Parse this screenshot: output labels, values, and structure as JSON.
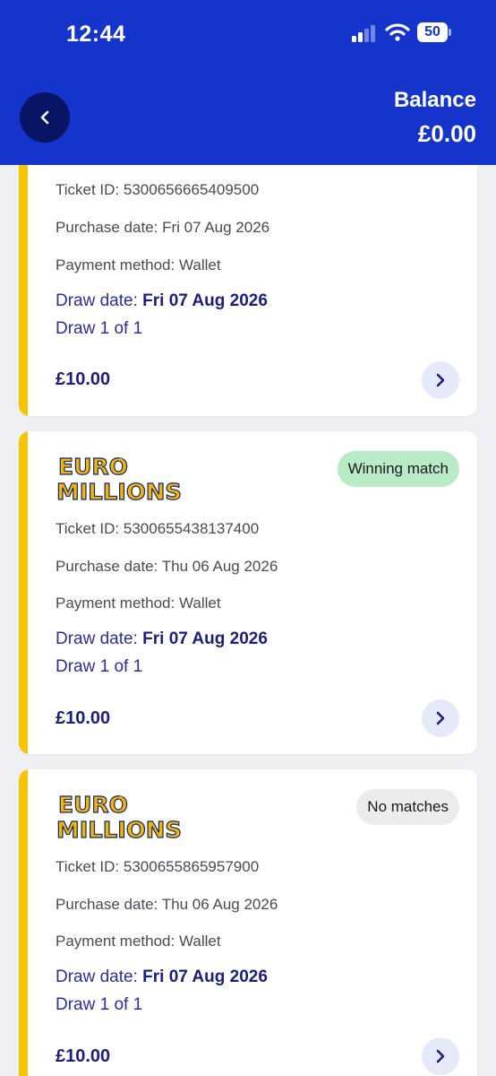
{
  "status_bar": {
    "time": "12:44",
    "battery": "50"
  },
  "header": {
    "balance_label": "Balance",
    "balance_value": "£0.00"
  },
  "colors": {
    "brand_blue": "#1434cb",
    "back_button": "#081564",
    "accent_yellow": "#f8c300",
    "win_badge": "#b9ecc6",
    "none_badge": "#ececee"
  },
  "tickets": [
    {
      "ticket_id": "Ticket ID: 5300656665409500",
      "purchase_date": "Purchase date: Fri 07 Aug 2026",
      "payment_method": "Payment method: Wallet",
      "draw_date_label": "Draw date: ",
      "draw_date_value": "Fri 07 Aug 2026",
      "draw_count": "Draw 1 of 1",
      "price": "£10.00"
    },
    {
      "logo_line1": "EURO",
      "logo_line2": "MILLIONS",
      "status": "Winning match",
      "ticket_id": "Ticket ID: 5300655438137400",
      "purchase_date": "Purchase date: Thu 06 Aug 2026",
      "payment_method": "Payment method: Wallet",
      "draw_date_label": "Draw date: ",
      "draw_date_value": "Fri 07 Aug 2026",
      "draw_count": "Draw 1 of 1",
      "price": "£10.00"
    },
    {
      "logo_line1": "EURO",
      "logo_line2": "MILLIONS",
      "status": "No matches",
      "ticket_id": "Ticket ID: 5300655865957900",
      "purchase_date": "Purchase date: Thu 06 Aug 2026",
      "payment_method": "Payment method: Wallet",
      "draw_date_label": "Draw date: ",
      "draw_date_value": "Fri 07 Aug 2026",
      "draw_count": "Draw 1 of 1",
      "price": "£10.00"
    }
  ]
}
